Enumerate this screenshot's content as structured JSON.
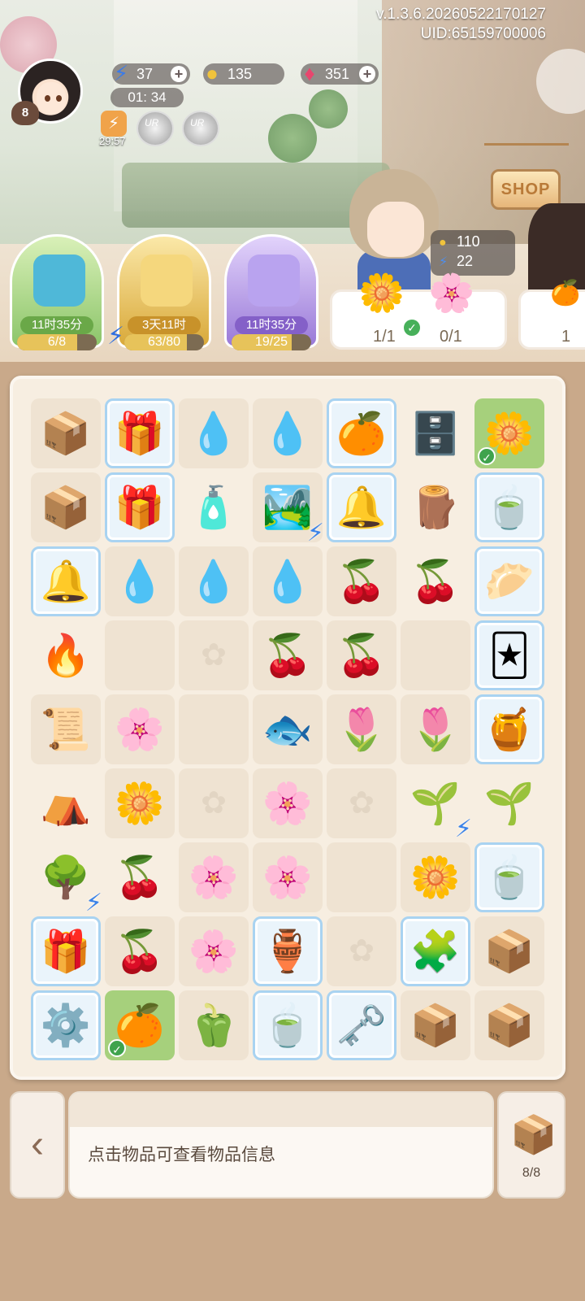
{
  "header": {
    "version": "v.1.3.6.20260522170127",
    "uid": "UID:65159700006",
    "player_level": "8",
    "energy": "37",
    "coins": "135",
    "gems": "351",
    "energy_timer": "01: 34",
    "boost_timer": "29:57",
    "ur_label": "UR",
    "shop_label": "SHOP"
  },
  "customer": {
    "coins": "110",
    "energy": "22"
  },
  "events": [
    {
      "timer": "11时35分",
      "progress_text": "6/8",
      "progress": 0.75,
      "color": "#8cc56a"
    },
    {
      "timer": "3天11时",
      "progress_text": "63/80",
      "progress": 0.79,
      "color": "#d9a93a"
    },
    {
      "timer": "11时35分",
      "progress_text": "19/25",
      "progress": 0.76,
      "color": "#9a7ad8"
    }
  ],
  "orders": [
    {
      "label1": "1/1",
      "label2": "0/1"
    },
    {
      "label1": "1"
    }
  ],
  "board": {
    "rows": [
      [
        {
          "i": "📦",
          "t": "empty"
        },
        {
          "i": "🎁",
          "t": "frozen"
        },
        {
          "i": "💧",
          "t": "empty"
        },
        {
          "i": "💧",
          "t": "empty"
        },
        {
          "i": "🍊",
          "t": "frozen"
        },
        {
          "i": "🗄️",
          "t": "plain"
        },
        {
          "i": "🌼",
          "t": "done"
        }
      ],
      [
        {
          "i": "📦",
          "t": "empty"
        },
        {
          "i": "🎁",
          "t": "frozen"
        },
        {
          "i": "🧴",
          "t": "plain"
        },
        {
          "i": "🏞️",
          "t": "empty",
          "b": true
        },
        {
          "i": "🔔",
          "t": "frozen"
        },
        {
          "i": "🪵",
          "t": "plain"
        },
        {
          "i": "🍵",
          "t": "frozen"
        }
      ],
      [
        {
          "i": "🔔",
          "t": "frozen"
        },
        {
          "i": "💧",
          "t": "empty"
        },
        {
          "i": "💧",
          "t": "empty"
        },
        {
          "i": "💧",
          "t": "empty"
        },
        {
          "i": "🍒",
          "t": "empty"
        },
        {
          "i": "🍒",
          "t": "plain"
        },
        {
          "i": "🥟",
          "t": "frozen"
        }
      ],
      [
        {
          "i": "🔥",
          "t": "plain"
        },
        {
          "i": "",
          "t": "empty"
        },
        {
          "i": "✿",
          "t": "ghost"
        },
        {
          "i": "🍒",
          "t": "empty"
        },
        {
          "i": "🍒",
          "t": "empty"
        },
        {
          "i": "",
          "t": "empty"
        },
        {
          "i": "🃏",
          "t": "frozen"
        }
      ],
      [
        {
          "i": "📜",
          "t": "empty"
        },
        {
          "i": "🌸",
          "t": "empty"
        },
        {
          "i": "",
          "t": "empty"
        },
        {
          "i": "🐟",
          "t": "empty"
        },
        {
          "i": "🌷",
          "t": "empty"
        },
        {
          "i": "🌷",
          "t": "empty"
        },
        {
          "i": "🍯",
          "t": "frozen"
        }
      ],
      [
        {
          "i": "⛺",
          "t": "plain"
        },
        {
          "i": "🌼",
          "t": "empty"
        },
        {
          "i": "✿",
          "t": "ghost"
        },
        {
          "i": "🌸",
          "t": "empty"
        },
        {
          "i": "✿",
          "t": "ghost"
        },
        {
          "i": "🌱",
          "t": "plain",
          "b": true
        },
        {
          "i": "🌱",
          "t": "plain"
        }
      ],
      [
        {
          "i": "🌳",
          "t": "plain",
          "b": true
        },
        {
          "i": "🍒",
          "t": "plain"
        },
        {
          "i": "🌸",
          "t": "empty"
        },
        {
          "i": "🌸",
          "t": "empty"
        },
        {
          "i": "",
          "t": "empty"
        },
        {
          "i": "🌼",
          "t": "empty"
        },
        {
          "i": "🍵",
          "t": "frozen"
        }
      ],
      [
        {
          "i": "🎁",
          "t": "frozen"
        },
        {
          "i": "🍒",
          "t": "empty"
        },
        {
          "i": "🌸",
          "t": "empty"
        },
        {
          "i": "🏺",
          "t": "frozen"
        },
        {
          "i": "✿",
          "t": "ghost"
        },
        {
          "i": "🧩",
          "t": "frozen"
        },
        {
          "i": "📦",
          "t": "empty"
        }
      ],
      [
        {
          "i": "⚙️",
          "t": "frozen"
        },
        {
          "i": "🍊",
          "t": "done"
        },
        {
          "i": "🫑",
          "t": "empty"
        },
        {
          "i": "🍵",
          "t": "frozen"
        },
        {
          "i": "🗝️",
          "t": "frozen"
        },
        {
          "i": "📦",
          "t": "empty"
        },
        {
          "i": "📦",
          "t": "empty"
        }
      ]
    ]
  },
  "footer": {
    "back_icon": "‹",
    "info_text": "点击物品可查看物品信息",
    "inventory_count": "8/8"
  }
}
